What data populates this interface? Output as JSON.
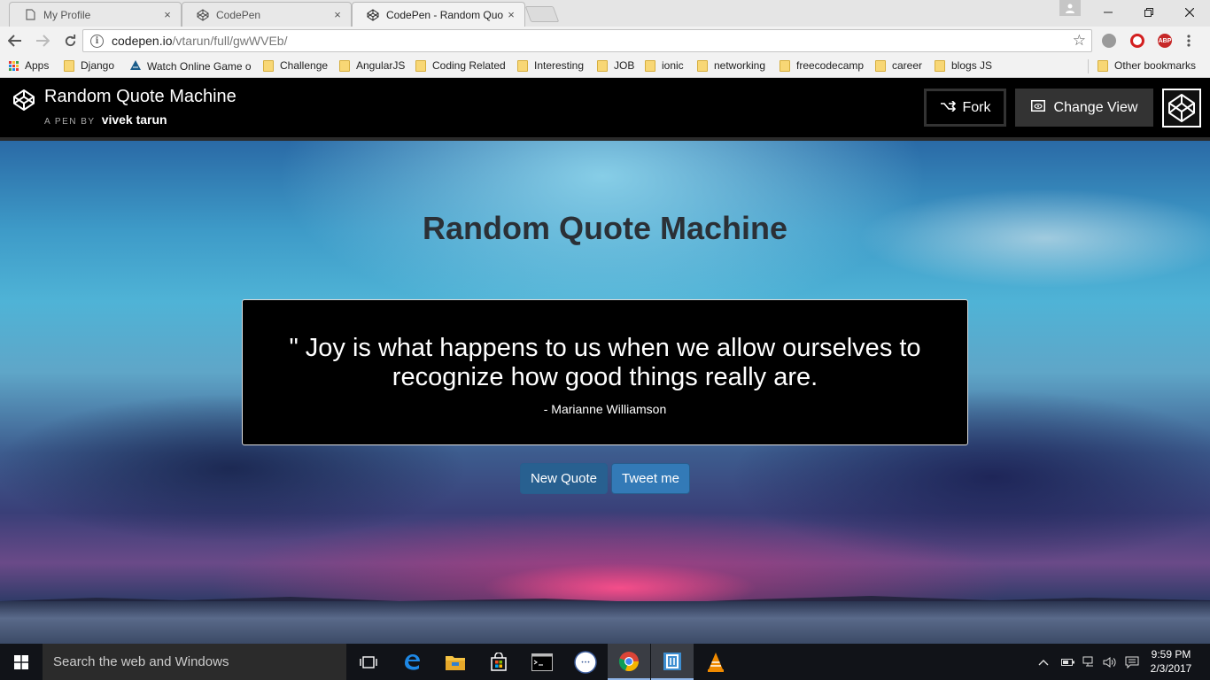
{
  "browser": {
    "tabs": [
      {
        "title": "My Profile",
        "active": false
      },
      {
        "title": "CodePen",
        "active": false
      },
      {
        "title": "CodePen - Random Quo",
        "active": true
      }
    ],
    "close_glyph": "×",
    "url_host": "codepen.io",
    "url_path": "/vtarun/full/gwWVEb/",
    "extensions": [
      "extension-icon",
      "opera-icon",
      "adblock-plus-icon",
      "menu-icon"
    ],
    "adblock_label": "ABP",
    "bookmarks": [
      {
        "label": "Apps",
        "icon": "apps-grid-icon"
      },
      {
        "label": "Django",
        "icon": "folder-icon"
      },
      {
        "label": "Watch Online Game o",
        "icon": "game-icon"
      },
      {
        "label": "Challenge",
        "icon": "folder-icon"
      },
      {
        "label": "AngularJS",
        "icon": "folder-icon"
      },
      {
        "label": "Coding Related",
        "icon": "folder-icon"
      },
      {
        "label": "Interesting",
        "icon": "folder-icon"
      },
      {
        "label": "JOB",
        "icon": "folder-icon"
      },
      {
        "label": "ionic",
        "icon": "folder-icon"
      },
      {
        "label": "networking",
        "icon": "folder-icon"
      },
      {
        "label": "freecodecamp",
        "icon": "folder-icon"
      },
      {
        "label": "career",
        "icon": "folder-icon"
      },
      {
        "label": "blogs JS",
        "icon": "folder-icon"
      }
    ],
    "other_bookmarks": "Other bookmarks"
  },
  "codepen": {
    "pen_title": "Random Quote Machine",
    "pen_by_prefix": "A PEN BY",
    "author": "vivek tarun",
    "fork_label": "Fork",
    "change_view_label": "Change View"
  },
  "app": {
    "heading": "Random Quote Machine",
    "quote": "\" Joy is what happens to us when we allow ourselves to recognize how good things really are.",
    "author": "- Marianne Williamson",
    "new_quote_label": "New Quote",
    "tweet_label": "Tweet me"
  },
  "taskbar": {
    "search_placeholder": "Search the web and Windows",
    "apps": [
      "task-view-icon",
      "edge-icon",
      "file-explorer-icon",
      "store-icon",
      "cmd-icon",
      "mozilla-maintenance-icon",
      "chrome-icon",
      "app-icon",
      "vlc-icon"
    ],
    "time": "9:59 PM",
    "date": "2/3/2017"
  },
  "colors": {
    "button_primary": "#337ab7",
    "header_bg": "#000000",
    "heading_text": "#2b3036"
  }
}
